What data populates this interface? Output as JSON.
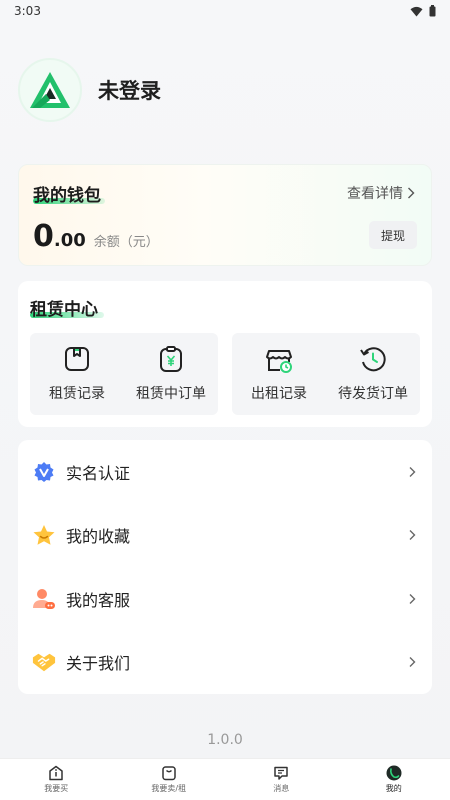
{
  "status_bar": {
    "time": "3:03"
  },
  "profile": {
    "name": "未登录"
  },
  "wallet": {
    "title": "我的钱包",
    "details_link": "查看详情",
    "balance_integer": "0",
    "balance_decimal": ".00",
    "balance_label": "余额（元）",
    "withdraw_label": "提现"
  },
  "rental_center": {
    "title": "租赁中心",
    "items": [
      {
        "label": "租赁记录",
        "icon": "bookmark-doc-icon"
      },
      {
        "label": "租赁中订单",
        "icon": "yen-clipboard-icon"
      },
      {
        "label": "出租记录",
        "icon": "store-clock-icon"
      },
      {
        "label": "待发货订单",
        "icon": "history-clock-icon"
      }
    ]
  },
  "menu": {
    "items": [
      {
        "label": "实名认证",
        "icon": "verified-badge-icon"
      },
      {
        "label": "我的收藏",
        "icon": "star-icon"
      },
      {
        "label": "我的客服",
        "icon": "customer-service-icon"
      },
      {
        "label": "关于我们",
        "icon": "handshake-icon"
      }
    ]
  },
  "version": "1.0.0",
  "tabbar": {
    "items": [
      {
        "label": "我要买",
        "icon": "info-home-icon"
      },
      {
        "label": "我要卖/租",
        "icon": "bag-icon"
      },
      {
        "label": "消息",
        "icon": "message-icon"
      },
      {
        "label": "我的",
        "icon": "profile-avatar-icon",
        "active": true
      }
    ]
  },
  "colors": {
    "accent": "#2ed47a",
    "background": "#f5f6f8"
  }
}
